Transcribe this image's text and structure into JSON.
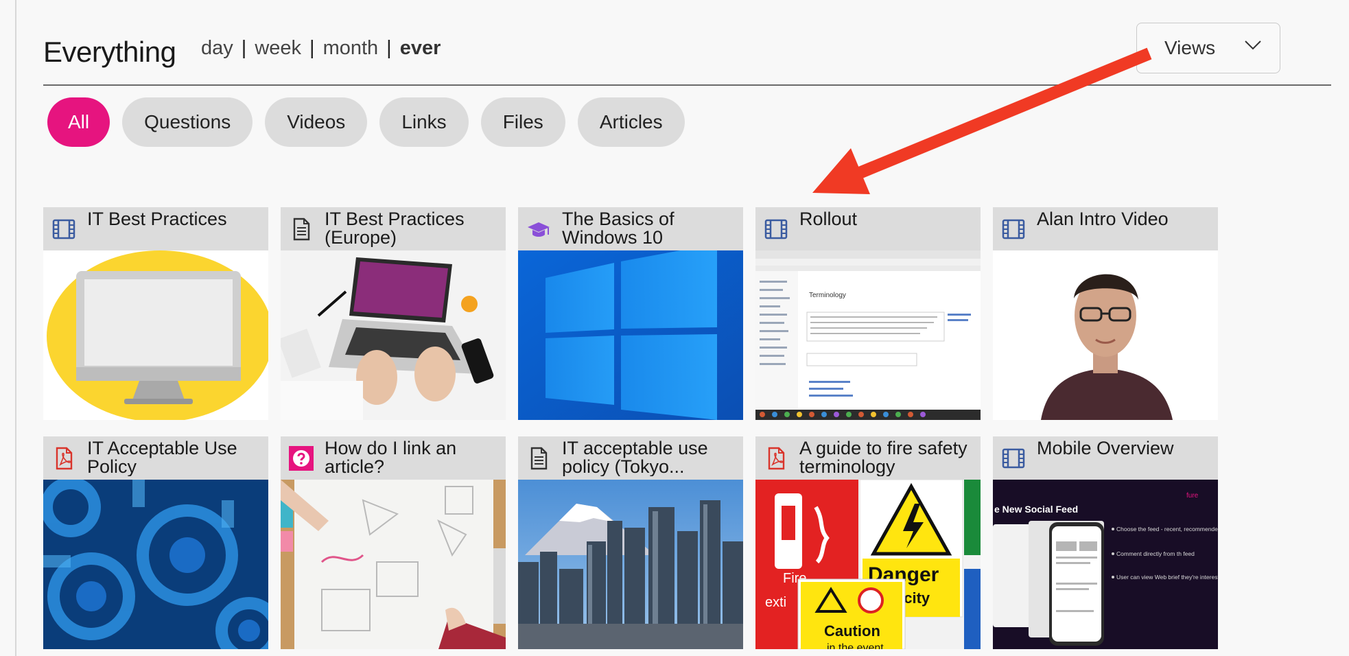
{
  "page": {
    "title": "Everything",
    "periods": [
      "day",
      "week",
      "month",
      "ever"
    ],
    "active_period": "ever",
    "sort_select": {
      "value": "Views"
    }
  },
  "filters": [
    {
      "label": "All",
      "active": true
    },
    {
      "label": "Questions",
      "active": false
    },
    {
      "label": "Videos",
      "active": false
    },
    {
      "label": "Links",
      "active": false
    },
    {
      "label": "Files",
      "active": false
    },
    {
      "label": "Articles",
      "active": false
    }
  ],
  "colors": {
    "accent_pink": "#e6147f",
    "arrow_red": "#f03a24",
    "icon_blue": "#3a5ba0",
    "icon_purple": "#8a4fd8",
    "icon_pdf_red": "#d9342b"
  },
  "cards": [
    {
      "title": "IT Best Practices",
      "icon": "video-icon",
      "thumb": "monitor-illustration"
    },
    {
      "title": "IT Best Practices (Europe)",
      "icon": "document-icon",
      "thumb": "laptop-typing-photo"
    },
    {
      "title": "The Basics of Windows 10",
      "icon": "graduation-cap-icon",
      "thumb": "windows-logo-photo"
    },
    {
      "title": "Rollout",
      "icon": "video-icon",
      "thumb": "webpage-screenshot"
    },
    {
      "title": "Alan Intro Video",
      "icon": "video-icon",
      "thumb": "presenter-photo"
    },
    {
      "title": "IT Acceptable Use Policy",
      "icon": "pdf-icon",
      "thumb": "gears-image"
    },
    {
      "title": "How do I link an article?",
      "icon": "question-icon",
      "thumb": "drawing-desk-photo"
    },
    {
      "title": "IT acceptable use policy (Tokyo...",
      "icon": "document-icon",
      "thumb": "tokyo-skyline-photo"
    },
    {
      "title": "A guide to fire safety terminology",
      "icon": "pdf-icon",
      "thumb": "safety-signs-photo"
    },
    {
      "title": "Mobile Overview",
      "icon": "video-icon",
      "thumb": "new-social-feed-slide"
    }
  ],
  "thumb_text": {
    "sign_fire": "Fire",
    "sign_exti": "exti",
    "sign_danger": "Danger",
    "sign_ctricity": "ctricity",
    "sign_caution": "Caution",
    "sign_in_the_event": "in the event",
    "screenshot_heading": "Terminology",
    "slide_heading": "e New Social Feed",
    "slide_brand": "fure",
    "slide_bullets": [
      "Choose the feed - recent, recommended or from th",
      "Comment directly from th feed",
      "User can view Web brief they're interested in"
    ]
  }
}
